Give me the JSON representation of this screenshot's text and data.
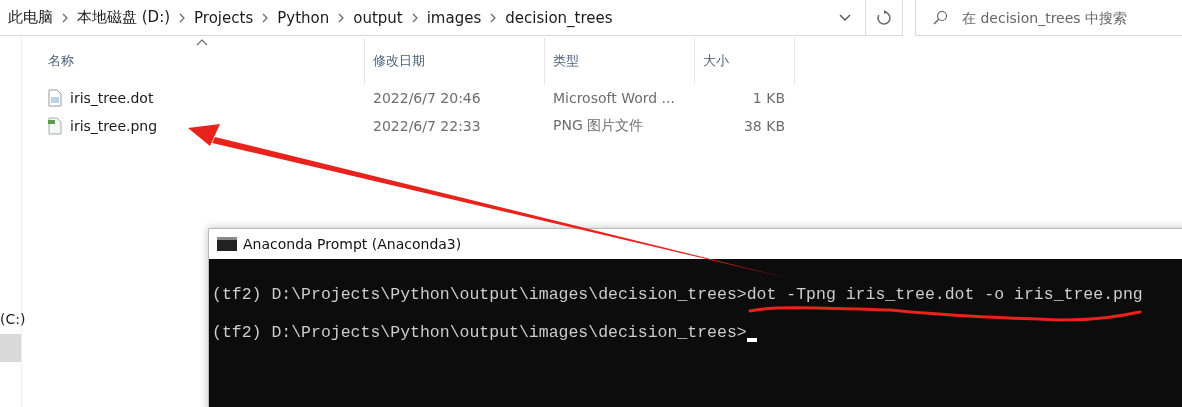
{
  "explorer": {
    "breadcrumb": [
      "此电脑",
      "本地磁盘 (D:)",
      "Projects",
      "Python",
      "output",
      "images",
      "decision_trees"
    ],
    "search": {
      "placeholder": "在 decision_trees 中搜索"
    },
    "nav_pane": [
      {
        "label": "(C:)",
        "selected": false
      },
      {
        "selected": true
      }
    ],
    "columns": [
      {
        "label": "名称",
        "sorted": true
      },
      {
        "label": "修改日期",
        "sorted": false
      },
      {
        "label": "类型",
        "sorted": false
      },
      {
        "label": "大小",
        "sorted": false
      }
    ],
    "files": [
      {
        "kind": "text",
        "name": "iris_tree.dot",
        "modified": "2022/6/7 20:46",
        "type": "Microsoft Word ...",
        "size": "1 KB"
      },
      {
        "kind": "image",
        "name": "iris_tree.png",
        "modified": "2022/6/7 22:33",
        "type": "PNG 图片文件",
        "size": "38 KB"
      }
    ]
  },
  "terminal": {
    "title": "Anaconda Prompt (Anaconda3)",
    "lines": [
      {
        "prompt": "(tf2) D:\\Projects\\Python\\output\\images\\decision_trees>",
        "command": "dot -Tpng iris_tree.dot -o iris_tree.png",
        "cursor": false
      },
      {
        "prompt": "(tf2) D:\\Projects\\Python\\output\\images\\decision_trees>",
        "cursor": true
      }
    ]
  }
}
